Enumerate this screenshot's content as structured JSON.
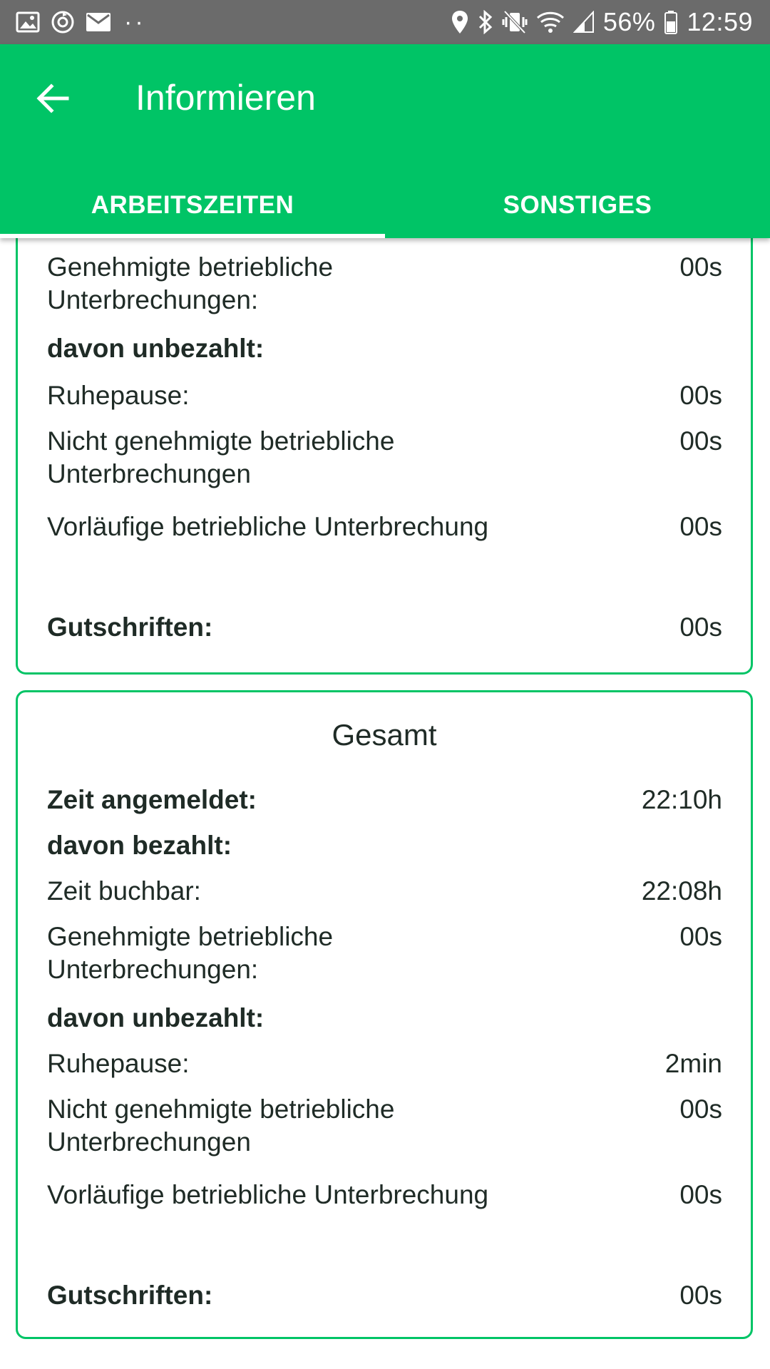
{
  "status_bar": {
    "icons_left": [
      "image-icon",
      "sync-icon",
      "mail-icon"
    ],
    "dots": "··",
    "icons_right": [
      "location-icon",
      "bluetooth-icon",
      "vibrate-icon",
      "wifi-icon",
      "signal-icon"
    ],
    "battery_percent": "56%",
    "time": "12:59"
  },
  "app_bar": {
    "title": "Informieren",
    "tabs": [
      {
        "label": "ARBEITSZEITEN",
        "active": true
      },
      {
        "label": "SONSTIGES",
        "active": false
      }
    ]
  },
  "card1": {
    "rows": [
      {
        "label": "Genehmigte betriebliche Unterbrechungen:",
        "value": "00s"
      },
      {
        "label": "davon unbezahlt:",
        "value": ""
      },
      {
        "label": "Ruhepause:",
        "value": "00s"
      },
      {
        "label": "Nicht genehmigte betriebliche Unterbrechungen",
        "value": "00s"
      },
      {
        "label": "Vorläufige betriebliche Unterbrechung",
        "value": "00s"
      },
      {
        "label": "Gutschriften:",
        "value": "00s"
      }
    ]
  },
  "card2": {
    "title": "Gesamt",
    "rows": [
      {
        "label": "Zeit angemeldet:",
        "value": "22:10h"
      },
      {
        "label": "davon bezahlt:",
        "value": ""
      },
      {
        "label": "Zeit buchbar:",
        "value": "22:08h"
      },
      {
        "label": "Genehmigte betriebliche Unterbrechungen:",
        "value": "00s"
      },
      {
        "label": "davon unbezahlt:",
        "value": ""
      },
      {
        "label": "Ruhepause:",
        "value": "2min"
      },
      {
        "label": "Nicht genehmigte betriebliche Unterbrechungen",
        "value": "00s"
      },
      {
        "label": "Vorläufige betriebliche Unterbrechung",
        "value": "00s"
      },
      {
        "label": "Gutschriften:",
        "value": "00s"
      }
    ]
  },
  "colors": {
    "accent": "#00c466",
    "status_bar": "#6b6b6b",
    "text": "#1f2b26"
  }
}
